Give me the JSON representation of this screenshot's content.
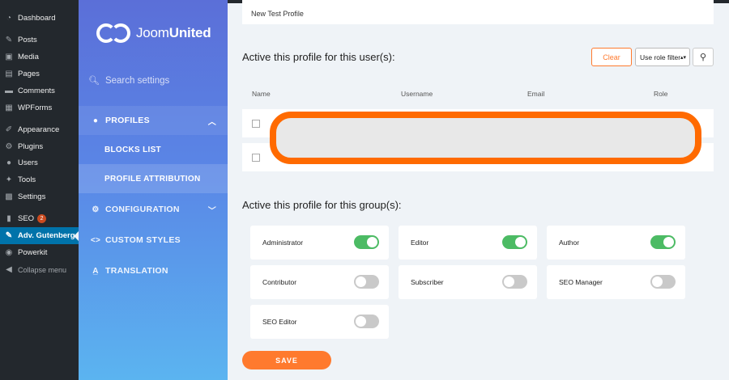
{
  "wp_menu": {
    "items": [
      {
        "label": "Dashboard",
        "icon": "dashboard-icon"
      },
      {
        "label": "Posts",
        "icon": "pushpin-icon"
      },
      {
        "label": "Media",
        "icon": "media-icon"
      },
      {
        "label": "Pages",
        "icon": "page-icon"
      },
      {
        "label": "Comments",
        "icon": "comment-icon"
      },
      {
        "label": "WPForms",
        "icon": "forms-icon"
      },
      {
        "label": "Appearance",
        "icon": "brush-icon"
      },
      {
        "label": "Plugins",
        "icon": "plugin-icon"
      },
      {
        "label": "Users",
        "icon": "user-icon"
      },
      {
        "label": "Tools",
        "icon": "wrench-icon"
      },
      {
        "label": "Settings",
        "icon": "settings-icon"
      },
      {
        "label": "SEO",
        "icon": "seo-icon",
        "badge": "2"
      },
      {
        "label": "Adv. Gutenberg",
        "icon": "pencil-icon"
      },
      {
        "label": "Powerkit",
        "icon": "powerkit-icon"
      },
      {
        "label": "Collapse menu",
        "icon": "collapse-icon"
      }
    ]
  },
  "plugin_nav": {
    "logo_part1": "Joom",
    "logo_part2": "United",
    "search_placeholder": "Search settings",
    "profiles": "PROFILES",
    "blocks_list": "BLOCKS LIST",
    "profile_attribution": "PROFILE ATTRIBUTION",
    "configuration": "CONFIGURATION",
    "custom_styles": "CUSTOM STYLES",
    "translation": "TRANSLATION"
  },
  "main": {
    "profile_name": "New Test Profile",
    "users_title": "Active this profile for this user(s):",
    "clear_label": "Clear",
    "role_filter": "Use role filter",
    "columns": [
      "Name",
      "Username",
      "Email",
      "Role"
    ],
    "groups_title": "Active this profile for this group(s):",
    "groups": [
      {
        "label": "Administrator",
        "enabled": true
      },
      {
        "label": "Editor",
        "enabled": true
      },
      {
        "label": "Author",
        "enabled": true
      },
      {
        "label": "Contributor",
        "enabled": false
      },
      {
        "label": "Subscriber",
        "enabled": false
      },
      {
        "label": "SEO Manager",
        "enabled": false
      },
      {
        "label": "SEO Editor",
        "enabled": false
      }
    ],
    "save_label": "SAVE"
  },
  "colors": {
    "accent": "#ff7a2e",
    "toggle_on": "#4cbb64",
    "wp_active": "#0073aa",
    "redaction": "#ff6a00"
  }
}
